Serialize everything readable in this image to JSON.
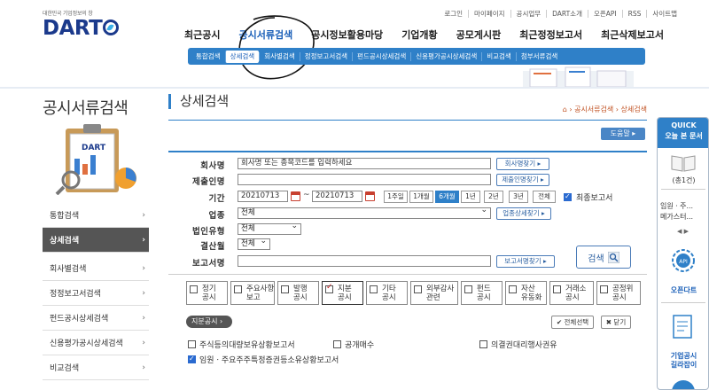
{
  "header": {
    "logo_tagline": "대한민국 기업정보의 창",
    "logo_text": "DART",
    "util_links": [
      "로그인",
      "마이페이지",
      "공시업무",
      "DART소개",
      "오픈API",
      "RSS",
      "사이트맵"
    ],
    "gnb": [
      "최근공시",
      "공시서류검색",
      "공시정보활용마당",
      "기업개황",
      "공모게시판",
      "최근정정보고서",
      "최근삭제보고서"
    ],
    "gnb_active": "공시서류검색",
    "subnav": [
      "통합검색",
      "상세검색",
      "회사별검색",
      "정정보고서검색",
      "펀드공시상세검색",
      "신용평가공시상세검색",
      "비교검색",
      "첨부서류검색"
    ],
    "subnav_active": "상세검색"
  },
  "lnb": {
    "title": "공시서류검색",
    "clip_label": "DART",
    "items": [
      "통합검색",
      "상세검색",
      "회사별검색",
      "정정보고서검색",
      "펀드공시상세검색",
      "신용평가공시상세검색",
      "비교검색"
    ],
    "active": "상세검색",
    "chevron": "›"
  },
  "content": {
    "title": "상세검색",
    "breadcrumb": [
      "공시서류검색",
      "상세검색"
    ],
    "help_button": "도움말 ▸",
    "form": {
      "company_label": "회사명",
      "company_placeholder": "회사명 또는 종목코드를 입력하세요",
      "company_find_btn": "회사명찾기 ▸",
      "submitter_label": "제출인명",
      "submitter_find_btn": "제출인명찾기 ▸",
      "period_label": "기간",
      "date_from": "20210713",
      "date_sep": "~",
      "date_to": "20210713",
      "period_buttons": [
        "1주일",
        "1개월",
        "6개월",
        "1년",
        "2년",
        "3년",
        "전체"
      ],
      "period_active": "6개월",
      "final_report_label": "최종보고서",
      "final_report_checked": true,
      "industry_label": "업종",
      "industry_value": "전체",
      "industry_find_btn": "업종상세찾기 ▸",
      "corp_type_label": "법인유형",
      "corp_type_value": "전체",
      "fiscal_label": "결산월",
      "fiscal_value": "전체",
      "report_name_label": "보고서명",
      "report_find_btn": "보고서명찾기 ▸",
      "search_button": "검색"
    },
    "categories": [
      {
        "line1": "정기",
        "line2": "공시",
        "checked": false
      },
      {
        "line1": "주요사항",
        "line2": "보고",
        "checked": false
      },
      {
        "line1": "발행",
        "line2": "공시",
        "checked": false
      },
      {
        "line1": "지분",
        "line2": "공시",
        "checked": true
      },
      {
        "line1": "기타",
        "line2": "공시",
        "checked": false
      },
      {
        "line1": "외부감사",
        "line2": "관련",
        "checked": false
      },
      {
        "line1": "펀드",
        "line2": "공시",
        "checked": false
      },
      {
        "line1": "자산",
        "line2": "유동화",
        "checked": false
      },
      {
        "line1": "거래소",
        "line2": "공시",
        "checked": false
      },
      {
        "line1": "공정위",
        "line2": "공시",
        "checked": false
      }
    ],
    "sub_tag": "지분공시 ›",
    "select_all": "✔ 전체선택",
    "close": "✖ 닫기",
    "options": [
      {
        "label": "주식등의대량보유상황보고서",
        "checked": false
      },
      {
        "label": "공개매수",
        "checked": false
      },
      {
        "label": "의결권대리행사권유",
        "checked": false
      },
      {
        "label": "임원ㆍ주요주주특정증권등소유상황보고서",
        "checked": true
      }
    ]
  },
  "quick": {
    "title1": "QUICK",
    "title2": "오늘 본 문서",
    "page": "(총1건)",
    "doc1": "임원ㆍ주...",
    "doc2": "메가스터...",
    "api_label": "오픈다트",
    "api_icon_text": "API",
    "guide_label1": "기업공시",
    "guide_label2": "길라잡이"
  }
}
